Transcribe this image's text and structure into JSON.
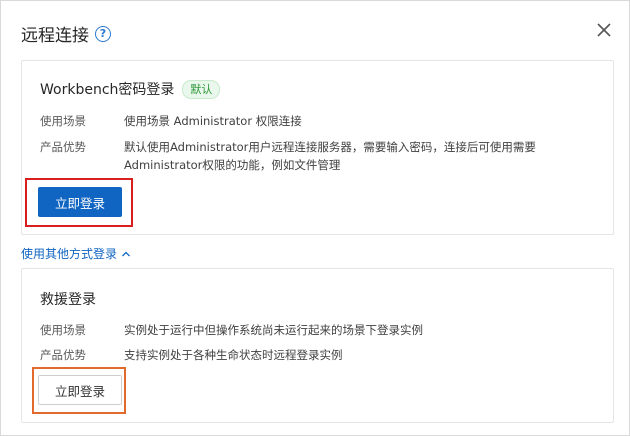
{
  "dialog": {
    "title": "远程连接"
  },
  "workbench": {
    "title": "Workbench密码登录",
    "badge": "默认",
    "scenario_label": "使用场景",
    "scenario_value": "使用场景 Administrator 权限连接",
    "advantage_label": "产品优势",
    "advantage_value": "默认使用Administrator用户远程连接服务器，需要输入密码，连接后可使用需要Administrator权限的功能，例如文件管理",
    "login_label": "立即登录"
  },
  "other_methods": {
    "label": "使用其他方式登录"
  },
  "rescue": {
    "title": "救援登录",
    "scenario_label": "使用场景",
    "scenario_value": "实例处于运行中但操作系统尚未运行起来的场景下登录实例",
    "advantage_label": "产品优势",
    "advantage_value": "支持实例处于各种生命状态时远程登录实例",
    "login_label": "立即登录"
  },
  "colors": {
    "primary": "#1064c2",
    "badge_green": "#2c9a3a",
    "highlight_red": "#d81e1e",
    "highlight_orange": "#e26a2c"
  }
}
